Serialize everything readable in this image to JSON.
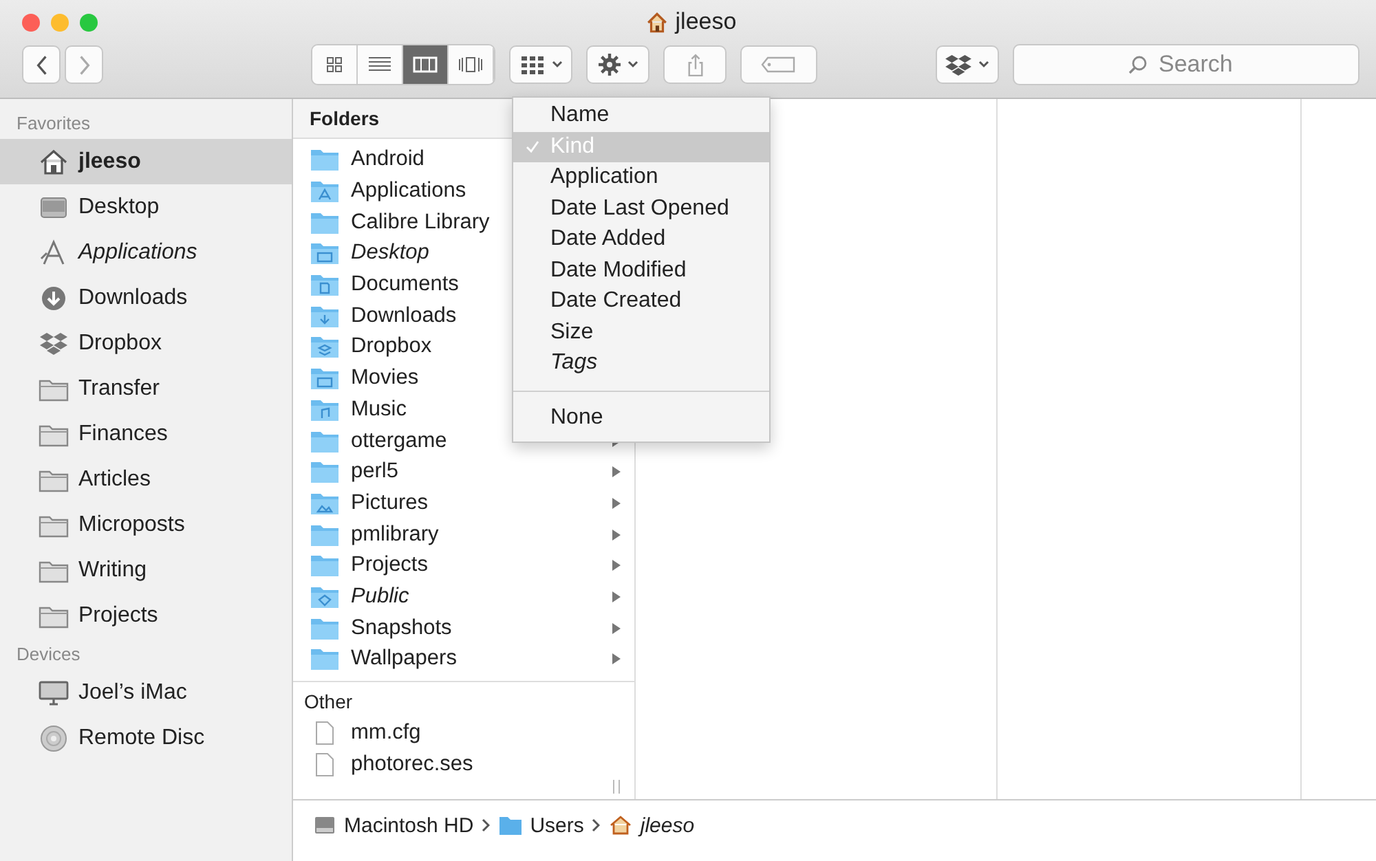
{
  "window": {
    "title": "jleeso"
  },
  "toolbar": {
    "view_buttons": [
      {
        "kind": "icons",
        "selected": false
      },
      {
        "kind": "list",
        "selected": false
      },
      {
        "kind": "columns",
        "selected": true
      },
      {
        "kind": "coverflow",
        "selected": false
      }
    ],
    "search": {
      "placeholder": "Search"
    }
  },
  "sidebar": {
    "sections": [
      {
        "title": "Favorites",
        "items": [
          {
            "kind": "home",
            "label": "jleeso",
            "selected": true,
            "italic": false
          },
          {
            "kind": "desktop",
            "label": "Desktop",
            "selected": false,
            "italic": false
          },
          {
            "kind": "applications",
            "label": "Applications",
            "selected": false,
            "italic": true
          },
          {
            "kind": "downloads",
            "label": "Downloads",
            "selected": false,
            "italic": false
          },
          {
            "kind": "dropbox",
            "label": "Dropbox",
            "selected": false,
            "italic": false
          },
          {
            "kind": "folder",
            "label": "Transfer",
            "selected": false,
            "italic": false
          },
          {
            "kind": "folder",
            "label": "Finances",
            "selected": false,
            "italic": false
          },
          {
            "kind": "folder",
            "label": "Articles",
            "selected": false,
            "italic": false
          },
          {
            "kind": "folder",
            "label": "Microposts",
            "selected": false,
            "italic": false
          },
          {
            "kind": "folder",
            "label": "Writing",
            "selected": false,
            "italic": false
          },
          {
            "kind": "folder",
            "label": "Projects",
            "selected": false,
            "italic": false
          }
        ]
      },
      {
        "title": "Devices",
        "items": [
          {
            "kind": "imac",
            "label": "Joel’s iMac",
            "selected": false,
            "italic": false
          },
          {
            "kind": "disc",
            "label": "Remote Disc",
            "selected": false,
            "italic": false
          }
        ]
      }
    ]
  },
  "folders": {
    "title": "Folders",
    "items": [
      {
        "kind": "plain",
        "label": "Android",
        "italic": false
      },
      {
        "kind": "applications",
        "label": "Applications",
        "italic": false
      },
      {
        "kind": "plain",
        "label": "Calibre Library",
        "italic": false
      },
      {
        "kind": "desktop",
        "label": "Desktop",
        "italic": true
      },
      {
        "kind": "documents",
        "label": "Documents",
        "italic": false
      },
      {
        "kind": "downloads",
        "label": "Downloads",
        "italic": false
      },
      {
        "kind": "dropbox",
        "label": "Dropbox",
        "italic": false
      },
      {
        "kind": "movies",
        "label": "Movies",
        "italic": false
      },
      {
        "kind": "music",
        "label": "Music",
        "italic": false
      },
      {
        "kind": "plain",
        "label": "ottergame",
        "italic": false
      },
      {
        "kind": "plain",
        "label": "perl5",
        "italic": false
      },
      {
        "kind": "pictures",
        "label": "Pictures",
        "italic": false
      },
      {
        "kind": "plain",
        "label": "pmlibrary",
        "italic": false
      },
      {
        "kind": "plain",
        "label": "Projects",
        "italic": false
      },
      {
        "kind": "public",
        "label": "Public",
        "italic": true
      },
      {
        "kind": "plain",
        "label": "Snapshots",
        "italic": false
      },
      {
        "kind": "plain",
        "label": "Wallpapers",
        "italic": false
      }
    ]
  },
  "other": {
    "title": "Other",
    "items": [
      {
        "label": "mm.cfg"
      },
      {
        "label": "photorec.ses"
      }
    ]
  },
  "arrange_menu": {
    "groups": [
      [
        {
          "label": "Name",
          "selected": false,
          "italic": false
        },
        {
          "label": "Kind",
          "selected": true,
          "italic": false
        },
        {
          "label": "Application",
          "selected": false,
          "italic": false
        },
        {
          "label": "Date Last Opened",
          "selected": false,
          "italic": false
        },
        {
          "label": "Date Added",
          "selected": false,
          "italic": false
        },
        {
          "label": "Date Modified",
          "selected": false,
          "italic": false
        },
        {
          "label": "Date Created",
          "selected": false,
          "italic": false
        },
        {
          "label": "Size",
          "selected": false,
          "italic": false
        },
        {
          "label": "Tags",
          "selected": false,
          "italic": true
        }
      ],
      [
        {
          "label": "None",
          "selected": false,
          "italic": false
        }
      ]
    ]
  },
  "path_bar": [
    {
      "kind": "disk",
      "label": "Macintosh HD",
      "italic": false
    },
    {
      "kind": "folder",
      "label": "Users",
      "italic": false
    },
    {
      "kind": "home",
      "label": "jleeso",
      "italic": true
    }
  ]
}
